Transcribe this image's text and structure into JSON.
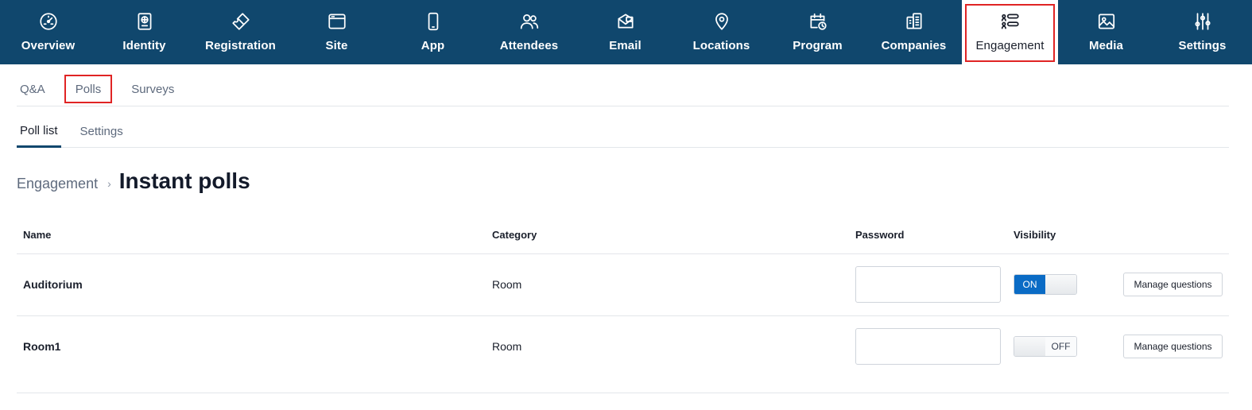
{
  "topnav": {
    "items": [
      {
        "label": "Overview",
        "icon": "dashboard-gauge-icon"
      },
      {
        "label": "Identity",
        "icon": "passport-icon"
      },
      {
        "label": "Registration",
        "icon": "ticket-icon"
      },
      {
        "label": "Site",
        "icon": "browser-window-icon"
      },
      {
        "label": "App",
        "icon": "mobile-phone-icon"
      },
      {
        "label": "Attendees",
        "icon": "people-icon"
      },
      {
        "label": "Email",
        "icon": "envelope-icon"
      },
      {
        "label": "Locations",
        "icon": "map-pin-icon"
      },
      {
        "label": "Program",
        "icon": "calendar-clock-icon"
      },
      {
        "label": "Companies",
        "icon": "building-icon"
      },
      {
        "label": "Engagement",
        "icon": "engagement-list-icon"
      },
      {
        "label": "Media",
        "icon": "image-icon"
      },
      {
        "label": "Settings",
        "icon": "sliders-icon"
      }
    ],
    "active": "Engagement",
    "colors": {
      "background": "#10476d",
      "highlight_border": "#e02424"
    }
  },
  "subtabs": {
    "items": [
      "Q&A",
      "Polls",
      "Surveys"
    ],
    "active": "Polls"
  },
  "innertabs": {
    "items": [
      "Poll list",
      "Settings"
    ],
    "active": "Poll list"
  },
  "breadcrumb": {
    "parent": "Engagement",
    "separator": "›",
    "title": "Instant polls"
  },
  "table": {
    "headers": {
      "name": "Name",
      "category": "Category",
      "password": "Password",
      "visibility": "Visibility"
    },
    "rows": [
      {
        "name": "Auditorium",
        "category": "Room",
        "password": "",
        "visibility": "ON",
        "action": "Manage questions"
      },
      {
        "name": "Room1",
        "category": "Room",
        "password": "",
        "visibility": "OFF",
        "action": "Manage questions"
      }
    ]
  },
  "colors": {
    "toggle_on": "#0a6bc5"
  }
}
